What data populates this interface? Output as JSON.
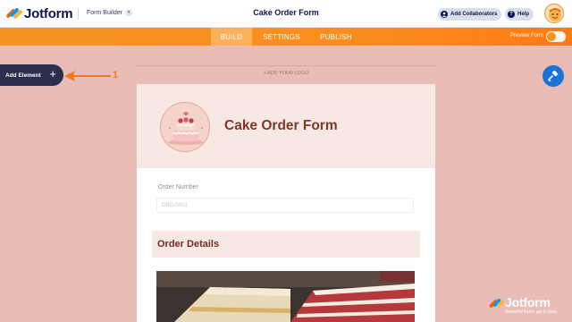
{
  "header": {
    "brand": "Jotform",
    "builder_label": "Form Builder",
    "form_title": "Cake Order Form",
    "add_collaborators": "Add Collaborators",
    "help": "Help"
  },
  "nav": {
    "tabs": [
      {
        "label": "BUILD",
        "active": true
      },
      {
        "label": "SETTINGS",
        "active": false
      },
      {
        "label": "PUBLISH",
        "active": false
      }
    ],
    "preview_label": "Preview Form",
    "preview_on": false
  },
  "sidebar": {
    "add_element_label": "Add Element",
    "callout_number": "1"
  },
  "canvas": {
    "add_logo_label": "+ ADD YOUR LOGO"
  },
  "form": {
    "title": "Cake Order Form",
    "order_number_label": "Order Number",
    "order_number_placeholder": "ORD-0001",
    "section_title": "Order Details"
  },
  "watermark": {
    "brand": "Jotform",
    "tagline": "Powerful forms get it done"
  },
  "colors": {
    "background": "#e9bcb6",
    "navbar": "#f7931e",
    "brand_navy": "#0a1551",
    "title_brown": "#7a3a2a",
    "paint_button": "#1a73d9"
  }
}
